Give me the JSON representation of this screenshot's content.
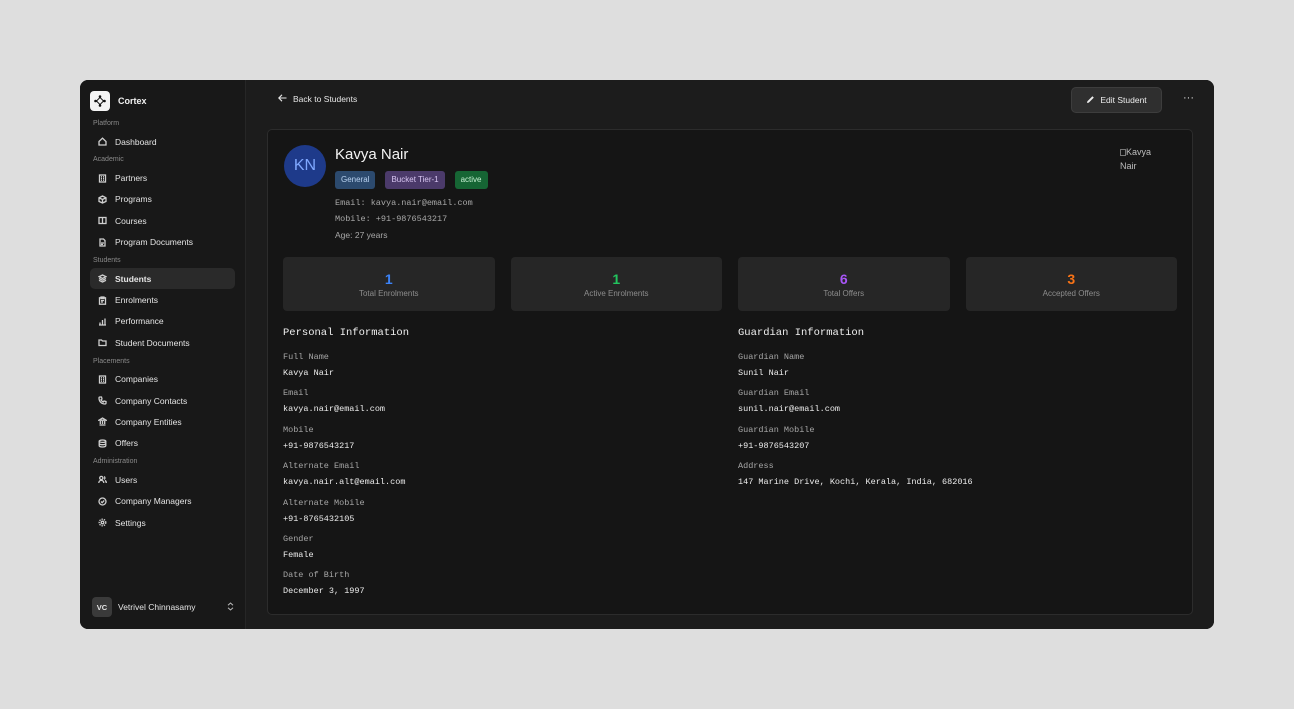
{
  "app": {
    "name": "Cortex"
  },
  "sidebar": {
    "sections": [
      {
        "label": "Platform",
        "items": [
          {
            "label": "Dashboard",
            "icon": "home-icon"
          }
        ]
      },
      {
        "label": "Academic",
        "items": [
          {
            "label": "Partners",
            "icon": "building-icon"
          },
          {
            "label": "Programs",
            "icon": "cube-icon"
          },
          {
            "label": "Courses",
            "icon": "book-icon"
          },
          {
            "label": "Program Documents",
            "icon": "file-icon"
          }
        ]
      },
      {
        "label": "Students",
        "items": [
          {
            "label": "Students",
            "icon": "stack-icon",
            "active": true
          },
          {
            "label": "Enrolments",
            "icon": "clipboard-icon"
          },
          {
            "label": "Performance",
            "icon": "bar-chart-icon"
          },
          {
            "label": "Student Documents",
            "icon": "folder-icon"
          }
        ]
      },
      {
        "label": "Placements",
        "items": [
          {
            "label": "Companies",
            "icon": "building-icon"
          },
          {
            "label": "Company Contacts",
            "icon": "phone-icon"
          },
          {
            "label": "Company Entities",
            "icon": "bank-icon"
          },
          {
            "label": "Offers",
            "icon": "database-icon"
          }
        ]
      },
      {
        "label": "Administration",
        "items": [
          {
            "label": "Users",
            "icon": "users-icon"
          },
          {
            "label": "Company Managers",
            "icon": "badge-icon"
          },
          {
            "label": "Settings",
            "icon": "gear-icon"
          }
        ]
      }
    ],
    "user": {
      "initials": "VC",
      "name": "Vetrivel Chinnasamy"
    }
  },
  "topbar": {
    "back_label": "Back to Students",
    "edit_label": "Edit Student",
    "more_label": "···"
  },
  "student": {
    "initials": "KN",
    "name": "Kavya Nair",
    "badges": [
      "General",
      "Bucket Tier-1",
      "active"
    ],
    "email_line": "Email: kavya.nair@email.com",
    "mobile_line": "Mobile: +91-9876543217",
    "age_line": "Age: 27 years",
    "photo_alt": "Kavya Nair"
  },
  "stats": [
    {
      "value": "1",
      "label": "Total Enrolments",
      "color": "#3b82f6"
    },
    {
      "value": "1",
      "label": "Active Enrolments",
      "color": "#22c55e"
    },
    {
      "value": "6",
      "label": "Total Offers",
      "color": "#a855f7"
    },
    {
      "value": "3",
      "label": "Accepted Offers",
      "color": "#f97316"
    }
  ],
  "personal": {
    "heading": "Personal Information",
    "fields": [
      {
        "label": "Full Name",
        "value": "Kavya Nair"
      },
      {
        "label": "Email",
        "value": "kavya.nair@email.com"
      },
      {
        "label": "Mobile",
        "value": "+91-9876543217"
      },
      {
        "label": "Alternate Email",
        "value": "kavya.nair.alt@email.com"
      },
      {
        "label": "Alternate Mobile",
        "value": "+91-8765432105"
      },
      {
        "label": "Gender",
        "value": "Female"
      },
      {
        "label": "Date of Birth",
        "value": "December 3, 1997"
      }
    ]
  },
  "guardian": {
    "heading": "Guardian Information",
    "fields": [
      {
        "label": "Guardian Name",
        "value": "Sunil Nair"
      },
      {
        "label": "Guardian Email",
        "value": "sunil.nair@email.com"
      },
      {
        "label": "Guardian Mobile",
        "value": "+91-9876543207"
      },
      {
        "label": "Address",
        "value": "147 Marine Drive, Kochi, Kerala, India, 682016"
      }
    ]
  }
}
